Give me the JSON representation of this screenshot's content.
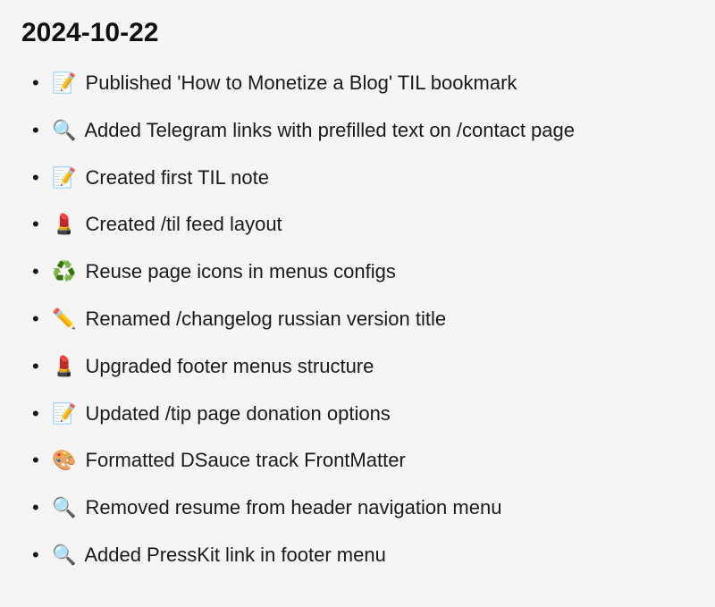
{
  "heading": "2024-10-22",
  "items": [
    {
      "emoji": "📝",
      "text": "Published 'How to Monetize a Blog' TIL bookmark"
    },
    {
      "emoji": "🔍",
      "text": "Added Telegram links with prefilled text on /contact page"
    },
    {
      "emoji": "📝",
      "text": "Created first TIL note"
    },
    {
      "emoji": "💄",
      "text": "Created /til feed layout"
    },
    {
      "emoji": "♻️",
      "text": "Reuse page icons in menus configs"
    },
    {
      "emoji": "✏️",
      "text": "Renamed /changelog russian version title"
    },
    {
      "emoji": "💄",
      "text": "Upgraded footer menus structure"
    },
    {
      "emoji": "📝",
      "text": "Updated /tip page donation options"
    },
    {
      "emoji": "🎨",
      "text": "Formatted DSauce track FrontMatter"
    },
    {
      "emoji": "🔍",
      "text": "Removed resume from header navigation menu"
    },
    {
      "emoji": "🔍",
      "text": "Added PressKit link in footer menu"
    }
  ]
}
